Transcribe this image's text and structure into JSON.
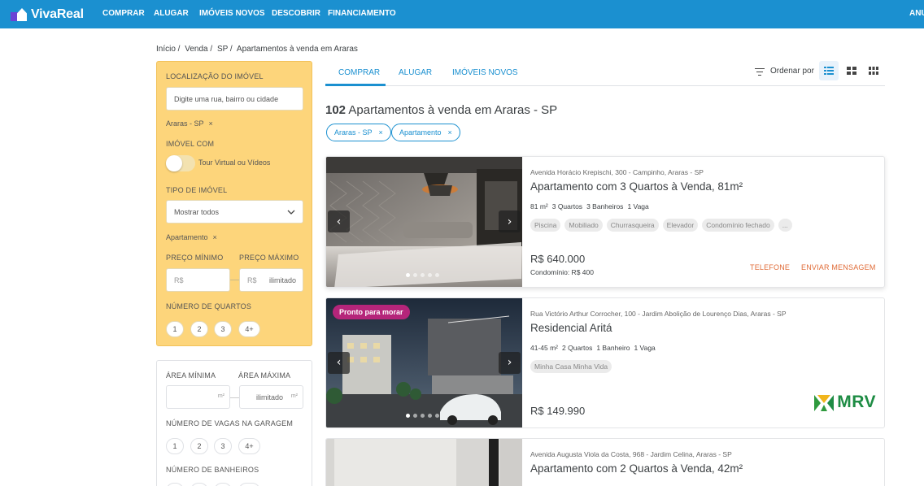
{
  "header": {
    "brand": "VivaReal",
    "nav": [
      "COMPRAR",
      "ALUGAR",
      "IMÓVEIS NOVOS",
      "DESCOBRIR",
      "FINANCIAMENTO"
    ],
    "right_label": "ANUNCIE",
    "colors": {
      "bar": "#1b90d0",
      "logo_accent": "#6b44d4"
    }
  },
  "breadcrumb": [
    "Início /",
    "Venda /",
    "SP /",
    "Apartamentos à venda em Araras"
  ],
  "filters": {
    "location_label": "LOCALIZAÇÃO DO IMÓVEL",
    "location_placeholder": "Digite uma rua, bairro ou cidade",
    "location_chip": "Araras - SP",
    "feature_label": "IMÓVEL COM",
    "tour_label": "Tour Virtual ou Vídeos",
    "type_label": "TIPO DE IMÓVEL",
    "type_value": "Mostrar todos",
    "type_chip": "Apartamento",
    "price_min_label": "PREÇO MÍNIMO",
    "price_max_label": "PREÇO MÁXIMO",
    "currency": "R$",
    "price_max_value": "ilimitado",
    "rooms_label": "NÚMERO DE QUARTOS",
    "rooms": [
      "1",
      "2",
      "3",
      "4+"
    ],
    "area_min_label": "ÁREA MÍNIMA",
    "area_max_label": "ÁREA MÁXIMA",
    "area_unit": "m²",
    "area_max_value": "ilimitado",
    "parking_label": "NÚMERO DE VAGAS NA GARAGEM",
    "parking": [
      "1",
      "2",
      "3",
      "4+"
    ],
    "bath_label": "NÚMERO DE BANHEIROS",
    "chip_remove": "×"
  },
  "tabs": [
    "COMPRAR",
    "ALUGAR",
    "IMÓVEIS NOVOS"
  ],
  "order_label": "Ordenar por",
  "results": {
    "count": "102",
    "title": "Apartamentos à venda em Araras - SP",
    "tags": [
      "Araras - SP",
      "Apartamento"
    ],
    "remove_glyph": "×"
  },
  "listings": [
    {
      "address": "Avenida Horácio Krepischi, 300 - Campinho, Araras - SP",
      "title": "Apartamento com 3 Quartos à Venda, 81m²",
      "features": [
        "81 m²",
        "3 Quartos",
        "3 Banheiros",
        "1 Vaga"
      ],
      "amenities": [
        "Piscina",
        "Mobiliado",
        "Churrasqueira",
        "Elevador",
        "Condomínio fechado",
        "..."
      ],
      "price": "R$ 640.000",
      "condo": "Condomínio: R$ 400",
      "actions": [
        "TELEFONE",
        "ENVIAR MENSAGEM"
      ]
    },
    {
      "badge": "Pronto para morar",
      "address": "Rua Victório Arthur Corrocher, 100 - Jardim Abolição de Lourenço Dias, Araras - SP",
      "title": "Residencial Aritá",
      "features": [
        "41-45 m²",
        "2 Quartos",
        "1 Banheiro",
        "1 Vaga"
      ],
      "amenities": [
        "Minha Casa Minha Vida"
      ],
      "price": "R$ 149.990",
      "brand": "MRV"
    },
    {
      "address": "Avenida Augusta Viola da Costa, 968 - Jardim Celina, Araras - SP",
      "title": "Apartamento com 2 Quartos à Venda, 42m²"
    }
  ],
  "icons": {
    "slider_prev": "‹",
    "slider_next": "›",
    "select_caret": "chevron-down-icon"
  }
}
